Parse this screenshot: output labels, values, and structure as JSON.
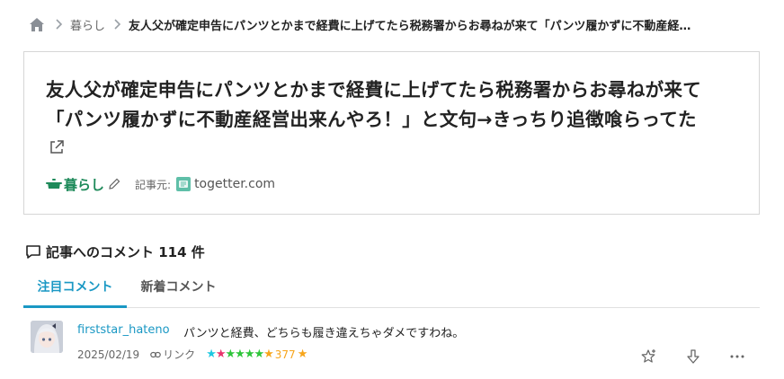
{
  "breadcrumb": {
    "home_icon": "home-icon",
    "items": [
      {
        "label": "暮らし"
      },
      {
        "label": "友人父が確定申告にパンツとかまで経費に上げてたら税務署からお尋ねが来て「パンツ履かずに不動産経…"
      }
    ]
  },
  "entry": {
    "title": "友人父が確定申告にパンツとかまで経費に上げてたら税務署からお尋ねが来て「パンツ履かずに不動産経営出来んやろ！」と文句→きっちり追徴喰らってた",
    "external_link_icon": "external-link-icon",
    "category": {
      "label": "暮らし",
      "icon": "pot-icon",
      "color": "#1e8a5a"
    },
    "edit_icon": "pencil-icon",
    "source_label": "記事元:",
    "source_domain": "togetter.com"
  },
  "comments": {
    "heading": "記事へのコメント 114 件",
    "heading_icon": "speech-bubble-icon",
    "tabs": [
      {
        "label": "注目コメント",
        "active": true
      },
      {
        "label": "新着コメント",
        "active": false
      }
    ],
    "items": [
      {
        "username": "firststar_hateno",
        "body": "パンツと経費、どちらも履き違えちゃダメですわね。",
        "date": "2025/02/19",
        "link_label": "リンク",
        "stars": [
          "#1ec8e0",
          "#e8336c",
          "#2ec43a",
          "#2ec43a",
          "#2ec43a",
          "#2ec43a",
          "#f7a51b"
        ],
        "star_count": "377",
        "actions": [
          "add-star-icon",
          "bury-icon",
          "more-icon"
        ]
      }
    ]
  },
  "colors": {
    "accent": "#1a98c4",
    "category": "#1e8a5a",
    "star_yellow": "#f7a51b"
  }
}
